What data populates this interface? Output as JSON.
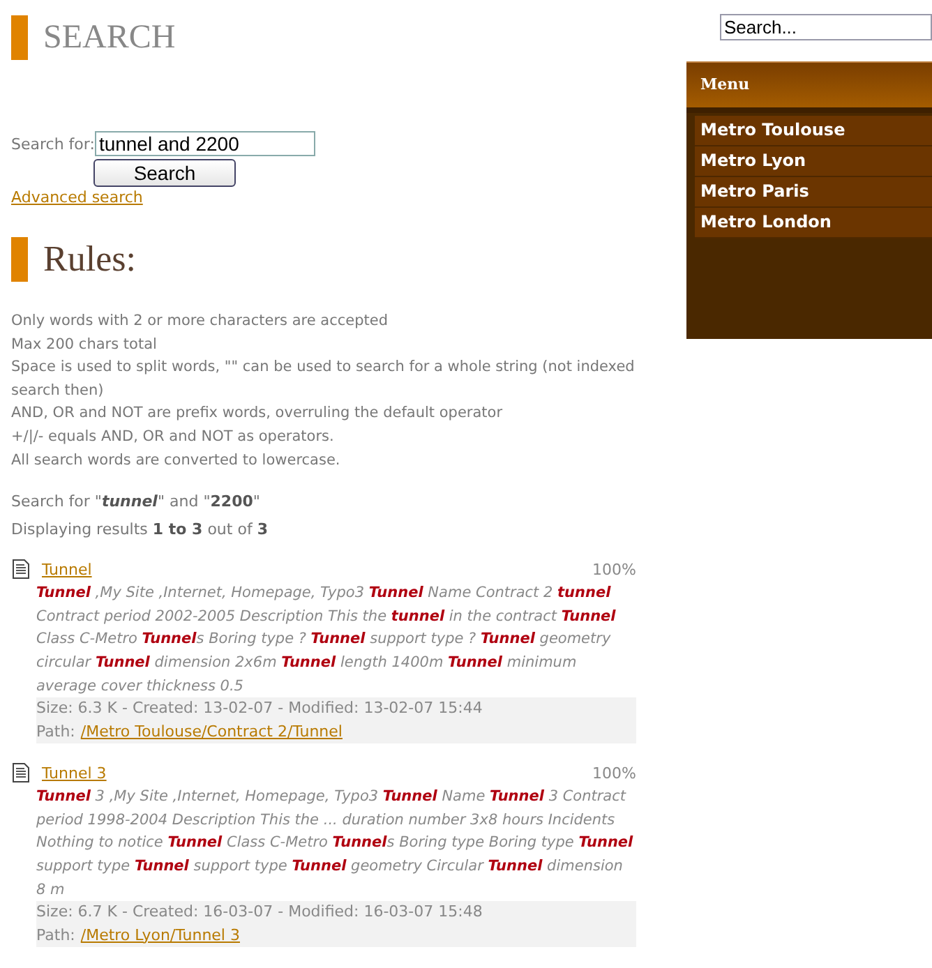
{
  "page_title": "SEARCH",
  "search_form": {
    "label": "Search for:",
    "value": "tunnel and 2200",
    "button": "Search",
    "advanced_link": "Advanced search"
  },
  "rules": {
    "title": "Rules:",
    "lines": [
      "Only words with 2 or more characters are accepted",
      "Max 200 chars total",
      "Space is used to split words, \"\" can be used to search for a whole string (not indexed search then)",
      "AND, OR and NOT are prefix words, overruling the default operator",
      "+/|/- equals AND, OR and NOT as operators.",
      "All search words are converted to lowercase."
    ]
  },
  "summary": "Search for \"**tunnel**\" and \"**2200**\"",
  "results_count": "Displaying results **1 to 3** out of **3**",
  "results": [
    {
      "title": "Tunnel",
      "score": "100%",
      "excerpt": "**Tunnel** ,My Site ,Internet, Homepage, Typo3 **Tunnel** Name Contract 2 **tunnel** Contract period 2002-2005 Description This the **tunnel** in the contract **Tunnel** Class C-Metro **Tunnel**s Boring type ? **Tunnel** support type ? **Tunnel** geometry circular **Tunnel** dimension 2x6m **Tunnel** length 1400m **Tunnel** minimum average cover thickness 0.5",
      "info": "Size: 6.3 K - Created: 13-02-07 - Modified: 13-02-07 15:44",
      "path_label": "Path:",
      "path": "/Metro Toulouse/Contract 2/Tunnel"
    },
    {
      "title": "Tunnel 3",
      "score": "100%",
      "excerpt": "**Tunnel** 3 ,My Site ,Internet, Homepage, Typo3 **Tunnel** Name **Tunnel** 3 Contract period 1998-2004 Description This the ... duration number 3x8 hours Incidents Nothing to notice **Tunnel** Class C-Metro **Tunnel**s Boring type Boring type **Tunnel** support type **Tunnel** support type **Tunnel** geometry Circular **Tunnel** dimension 8 m",
      "info": "Size: 6.7 K - Created: 16-03-07 - Modified: 16-03-07 15:48",
      "path_label": "Path:",
      "path": "/Metro Lyon/Tunnel 3"
    }
  ],
  "site_search": {
    "placeholder": "Search..."
  },
  "menu": {
    "title": "Menu",
    "items": [
      "Metro Toulouse",
      "Metro Lyon",
      "Metro Paris",
      "Metro London"
    ]
  }
}
